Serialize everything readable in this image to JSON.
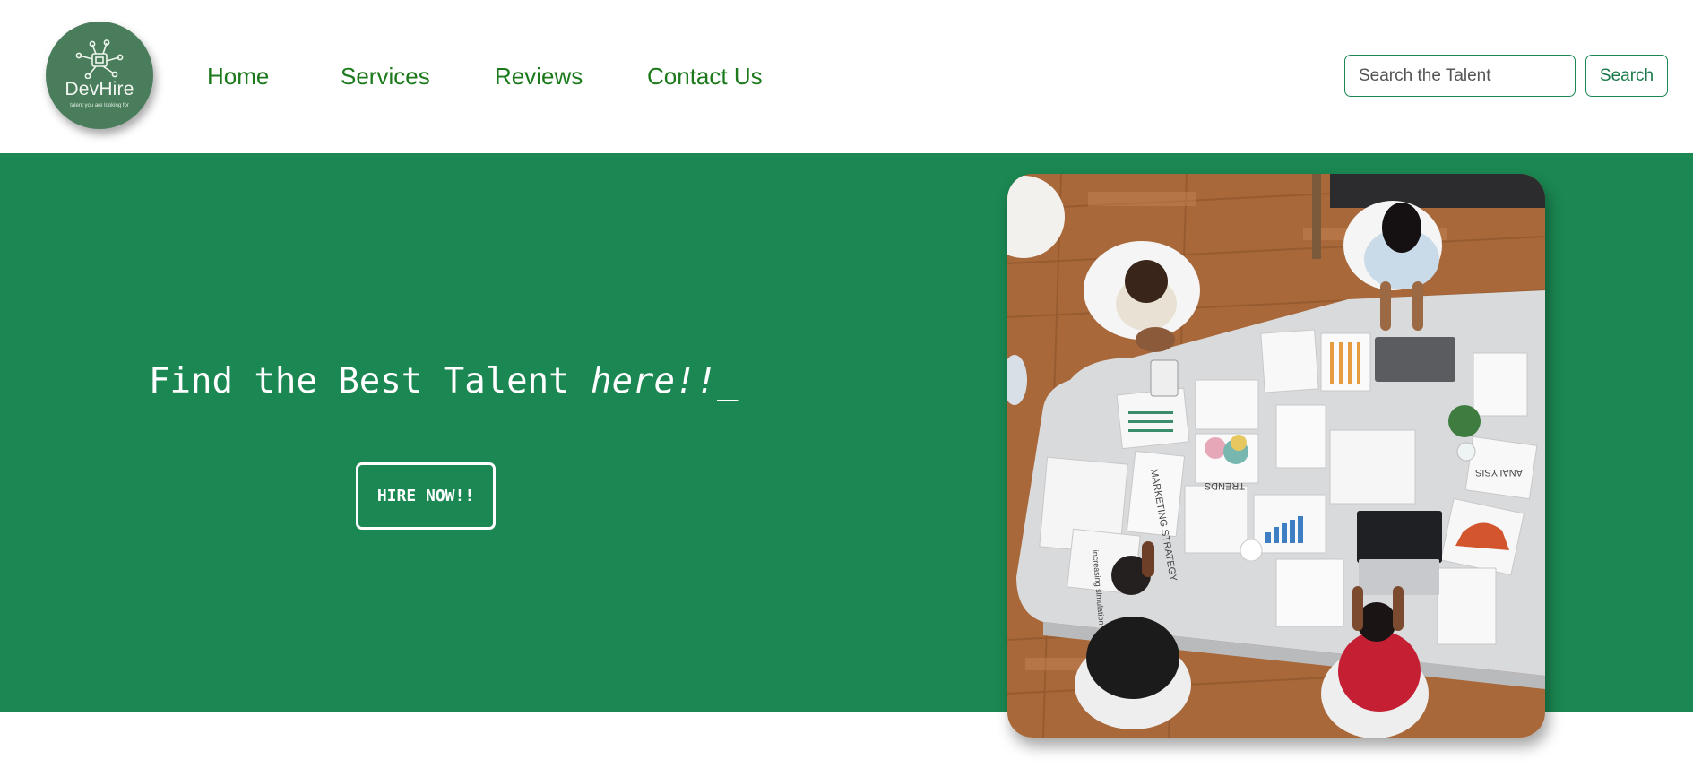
{
  "brand": {
    "name": "DevHire",
    "tagline": "talent you are looking for"
  },
  "nav": {
    "items": [
      "Home",
      "Services",
      "Reviews",
      "Contact Us"
    ]
  },
  "search": {
    "placeholder": "Search the Talent",
    "value": "",
    "button_label": "Search"
  },
  "hero": {
    "headline_main": "Find the Best Talent ",
    "headline_emphasis": "here!!",
    "cursor": "_",
    "cta_label": "HIRE NOW!!"
  },
  "photo": {
    "description_icon": "team-meeting-photo",
    "paper_labels": [
      "MARKETING STRATEGY",
      "TRENDS",
      "ANALYSIS",
      "increasing simulation"
    ]
  },
  "colors": {
    "brand_green": "#1b8752",
    "nav_green": "#1c7a1c",
    "logo_green": "#4a7d5c"
  }
}
